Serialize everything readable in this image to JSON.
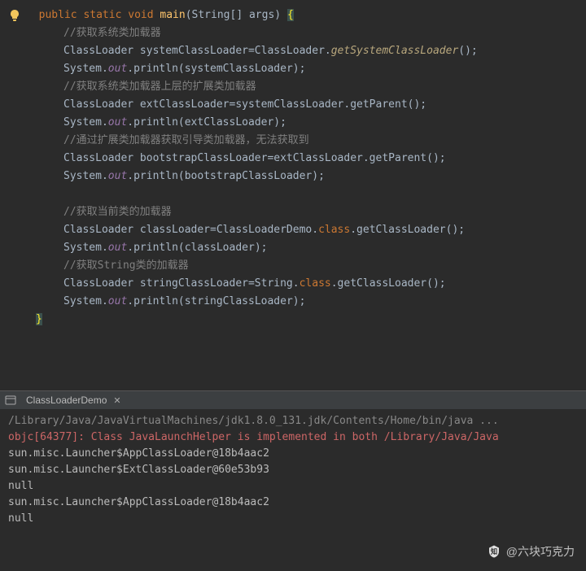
{
  "code": {
    "sig_public": "public",
    "sig_static": "static",
    "sig_void": "void",
    "sig_main": "main",
    "sig_params": "(String[] args)",
    "brace_open": "{",
    "brace_close": "}",
    "c1": "//获取系统类加载器",
    "l1": "ClassLoader systemClassLoader=ClassLoader.",
    "l1b": "getSystemClassLoader",
    "l1c": "();",
    "l2a": "System.",
    "l2b": "out",
    "l2c": ".println(systemClassLoader);",
    "c2": "//获取系统类加载器上层的扩展类加载器",
    "l3": "ClassLoader extClassLoader=systemClassLoader.getParent();",
    "l4a": "System.",
    "l4b": "out",
    "l4c": ".println(extClassLoader);",
    "c3": "//通过扩展类加载器获取引导类加载器，无法获取到",
    "l5": "ClassLoader bootstrapClassLoader=extClassLoader.getParent();",
    "l6a": "System.",
    "l6b": "out",
    "l6c": ".println(bootstrapClassLoader);",
    "c4": "//获取当前类的加载器",
    "l7a": "ClassLoader classLoader=ClassLoaderDemo.",
    "l7b": "class",
    "l7c": ".getClassLoader();",
    "l8a": "System.",
    "l8b": "out",
    "l8c": ".println(classLoader);",
    "c5": "//获取String类的加载器",
    "l9a": "ClassLoader stringClassLoader=String.",
    "l9b": "class",
    "l9c": ".getClassLoader();",
    "l10a": "System.",
    "l10b": "out",
    "l10c": ".println(stringClassLoader);"
  },
  "panel": {
    "tab_name": "ClassLoaderDemo"
  },
  "console": {
    "cmd": "/Library/Java/JavaVirtualMachines/jdk1.8.0_131.jdk/Contents/Home/bin/java ...",
    "err": "objc[64377]: Class JavaLaunchHelper is implemented in both /Library/Java/Java",
    "o1": "sun.misc.Launcher$AppClassLoader@18b4aac2",
    "o2": "sun.misc.Launcher$ExtClassLoader@60e53b93",
    "o3": "null",
    "o4": "sun.misc.Launcher$AppClassLoader@18b4aac2",
    "o5": "null"
  },
  "watermark": {
    "text": "@六块巧克力"
  }
}
